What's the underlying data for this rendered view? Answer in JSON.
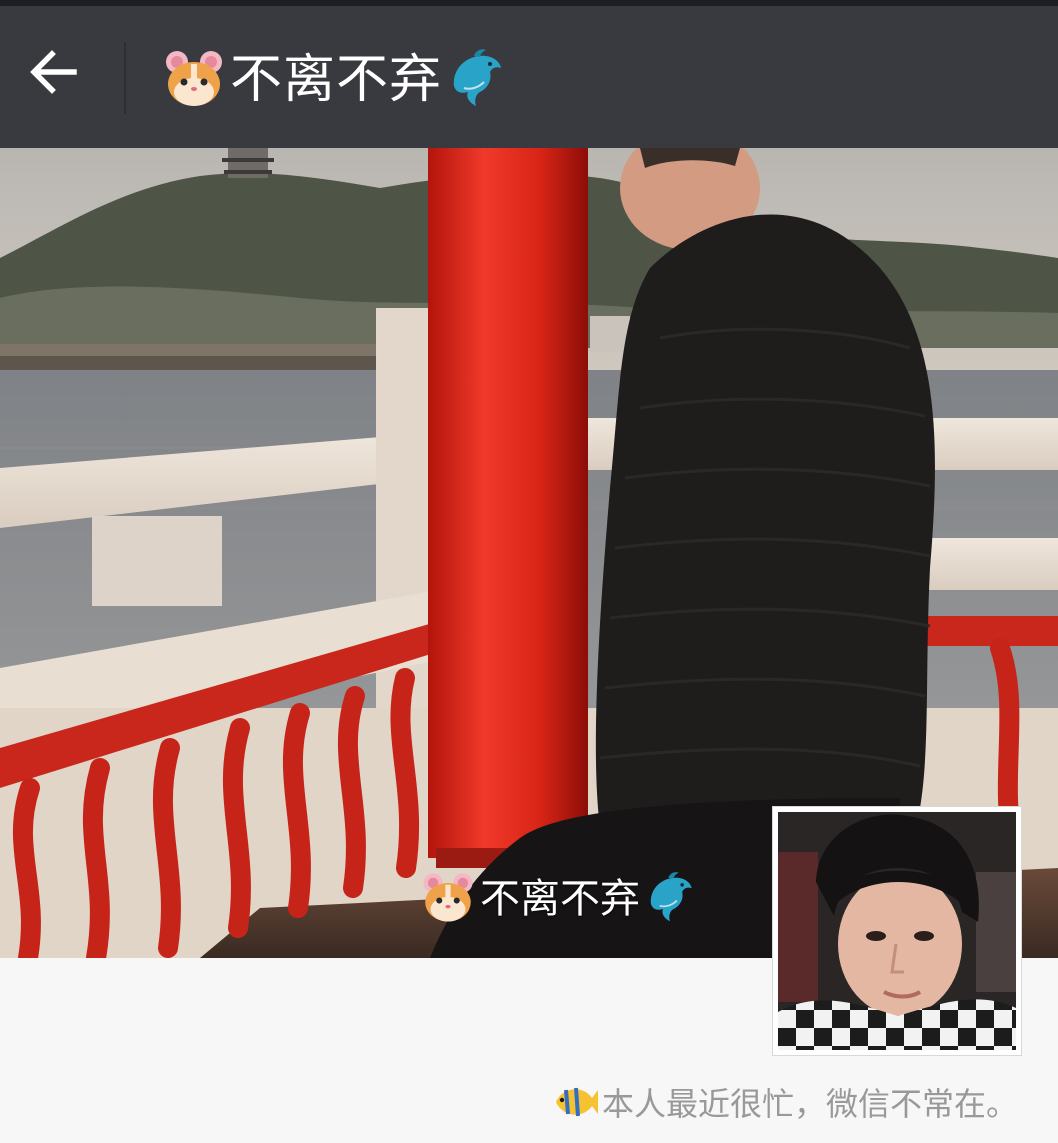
{
  "header": {
    "back_icon": "arrow-left-icon",
    "title_lead_icon": "hamster-face-icon",
    "title": "不离不弃",
    "title_trail_icon": "dolphin-icon",
    "background_color": "#393a3f"
  },
  "profile": {
    "cover_name_lead_icon": "hamster-face-icon",
    "cover_name": "不离不弃",
    "cover_name_trail_icon": "dolphin-icon",
    "signature_icon": "tropical-fish-icon",
    "signature": "本人最近很忙，微信不常在。"
  }
}
